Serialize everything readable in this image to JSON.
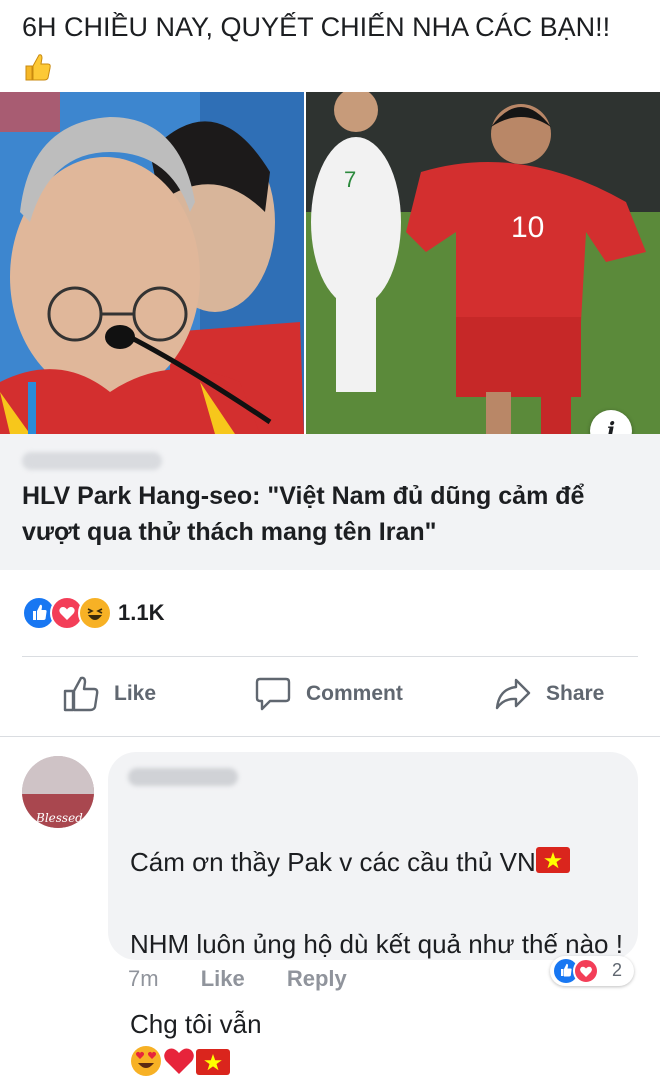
{
  "post": {
    "text": "6H CHIỀU NAY, QUYẾT CHIẾN NHA CÁC BẠN!!"
  },
  "link_card": {
    "info_label": "i",
    "title": "HLV Park Hang-seo: \"Việt Nam đủ dũng cảm để vượt qua thử thách mang tên Iran\"",
    "jersey_number": "10",
    "jersey_number_2": "7"
  },
  "reactions": {
    "count": "1.1K"
  },
  "actions": {
    "like": "Like",
    "comment": "Comment",
    "share": "Share"
  },
  "comment": {
    "line1": "Cám ơn thầy Pak v các cầu thủ VN",
    "line2": "NHM luôn ủng hộ dù kết quả như thế nào !",
    "line3": "Chg tôi vẫn",
    "time": "7m",
    "like": "Like",
    "reply": "Reply",
    "reaction_count": "2",
    "avatar_text": "Blessed"
  },
  "colors": {
    "like_blue": "#1877f2",
    "love_red": "#f33e58",
    "haha_yellow": "#f7b125",
    "vn_red": "#da251d",
    "vn_yellow": "#ffff00"
  }
}
